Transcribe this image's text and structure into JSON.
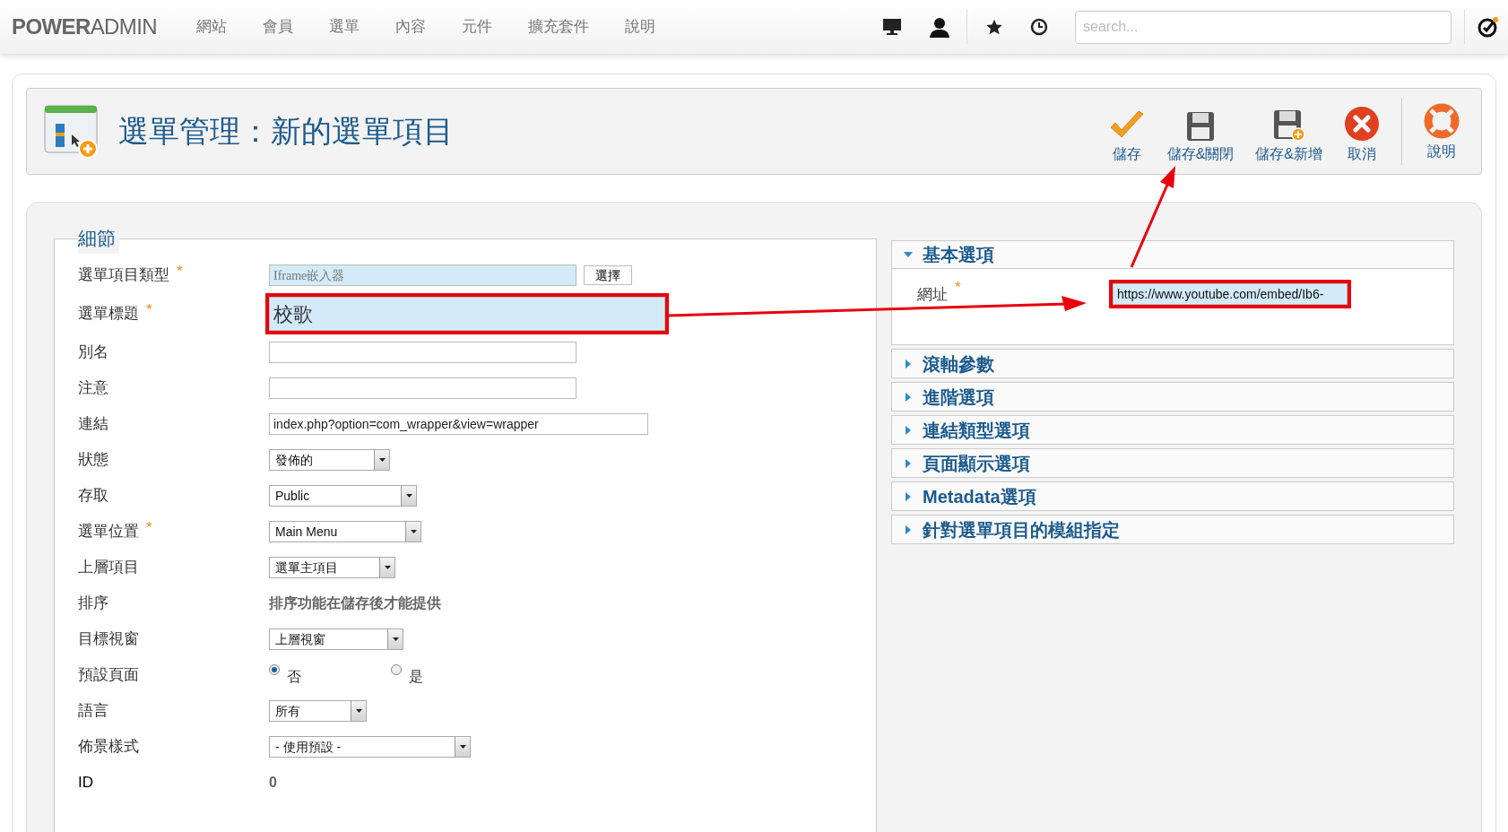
{
  "topbar": {
    "logo": "**POWER**ADMIN",
    "nav": [
      {
        "label": "網站"
      },
      {
        "label": "會員"
      },
      {
        "label": "選單"
      },
      {
        "label": "內容"
      },
      {
        "label": "元件"
      },
      {
        "label": "擴充套件"
      },
      {
        "label": "說明"
      }
    ],
    "search": {
      "placeholder": "search..."
    }
  },
  "header": {
    "title": "選單管理：新的選單項目",
    "toolbar": [
      {
        "kind": "check",
        "label": "儲存"
      },
      {
        "kind": "save",
        "label": "儲存&關閉"
      },
      {
        "kind": "save-new",
        "label": "儲存&新增"
      },
      {
        "kind": "cancel",
        "label": "取消"
      },
      {
        "kind": "help",
        "label": "說明"
      }
    ]
  },
  "details": {
    "legend": "細節",
    "rows": [
      {
        "kind": "readonly",
        "label": "選單項目類型",
        "mark": "*",
        "value": "Iframe嵌入器",
        "button": "選擇"
      },
      {
        "kind": "text",
        "label": "選單標題",
        "mark": "*",
        "value": "校歌",
        "focused": true,
        "annotated": true
      },
      {
        "kind": "text",
        "label": "別名",
        "value": ""
      },
      {
        "kind": "text",
        "label": "注意",
        "value": ""
      },
      {
        "kind": "text",
        "label": "連結",
        "value": "index.php?option=com_wrapper&view=wrapper"
      },
      {
        "kind": "select",
        "label": "狀態",
        "value": "發佈的"
      },
      {
        "kind": "select",
        "label": "存取",
        "value": "Public"
      },
      {
        "kind": "select",
        "label": "選單位置",
        "mark": "*",
        "value": "Main Menu"
      },
      {
        "kind": "select",
        "label": "上層項目",
        "value": "選單主項目"
      },
      {
        "kind": "static",
        "label": "排序",
        "value": "排序功能在儲存後才能提供"
      },
      {
        "kind": "select",
        "label": "目標視窗",
        "value": "上層視窗"
      },
      {
        "kind": "radio",
        "label": "預設頁面",
        "options": [
          {
            "label": "否",
            "selected": true
          },
          {
            "label": "是",
            "selected": false
          }
        ]
      },
      {
        "kind": "select",
        "label": "語言",
        "value": "所有"
      },
      {
        "kind": "select",
        "label": "佈景樣式",
        "value": "- 使用預設 -"
      },
      {
        "kind": "static",
        "label": "ID",
        "value": "0"
      }
    ]
  },
  "options": [
    {
      "title": "基本選項",
      "expanded": true,
      "fields": [
        {
          "label": "網址",
          "mark": "*",
          "value": "https://www.youtube.com/embed/Ib6-",
          "focused": true,
          "annotated": true
        }
      ]
    },
    {
      "title": "滾軸參數",
      "expanded": false
    },
    {
      "title": "進階選項",
      "expanded": false
    },
    {
      "title": "連結類型選項",
      "expanded": false
    },
    {
      "title": "頁面顯示選項",
      "expanded": false
    },
    {
      "title": "Metadata選項",
      "expanded": false
    },
    {
      "title": "針對選單項目的模組指定",
      "expanded": false
    }
  ]
}
